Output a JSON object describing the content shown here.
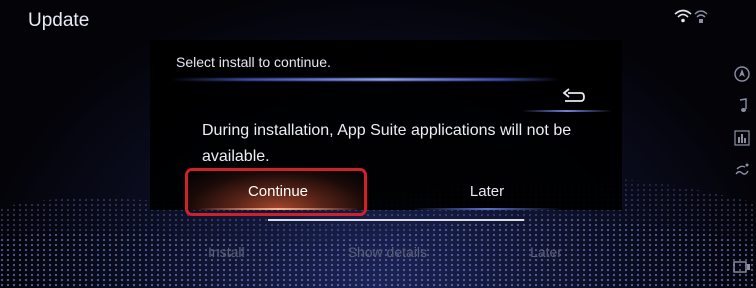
{
  "header": {
    "title": "Update",
    "status_icons": [
      "wifi-icon",
      "signal-icon"
    ]
  },
  "sidebar": {
    "icons": [
      "navigation-icon",
      "music-icon",
      "equalizer-icon",
      "climate-icon",
      "display-icon"
    ]
  },
  "background_buttons": {
    "install_label": "Install",
    "show_details_label": "Show details",
    "later_label": "Later"
  },
  "dialog": {
    "header_text": "Select install to continue.",
    "message": "During installation, App Suite applications will not be available.",
    "continue_label": "Continue",
    "later_label": "Later"
  },
  "colors": {
    "highlight": "#d0202a",
    "accent_blue": "#6f82d8",
    "continue_glow": "#a6492f"
  }
}
